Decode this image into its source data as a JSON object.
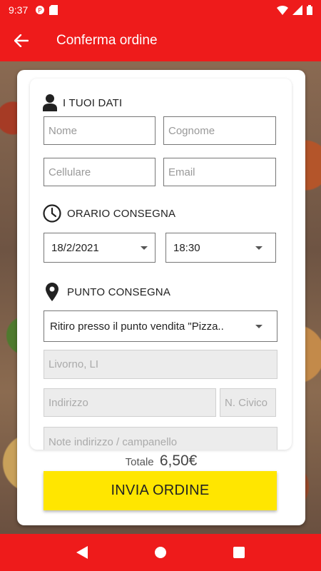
{
  "status_bar": {
    "time": "9:37"
  },
  "app_bar": {
    "title": "Conferma ordine"
  },
  "sections": {
    "personal": {
      "heading": "I TUOI DATI"
    },
    "schedule": {
      "heading": "ORARIO CONSEGNA"
    },
    "location": {
      "heading": "PUNTO CONSEGNA"
    }
  },
  "fields": {
    "nome": {
      "placeholder": "Nome"
    },
    "cognome": {
      "placeholder": "Cognome"
    },
    "cellulare": {
      "placeholder": "Cellulare"
    },
    "email": {
      "placeholder": "Email"
    },
    "date": {
      "value": "18/2/2021"
    },
    "time": {
      "value": "18:30"
    },
    "delivery_point": {
      "value": "Ritiro presso il punto vendita \"Pizza.."
    },
    "city": {
      "value": "Livorno, LI"
    },
    "indirizzo": {
      "placeholder": "Indirizzo"
    },
    "civico": {
      "placeholder": "N. Civico"
    },
    "note": {
      "placeholder": "Note indirizzo / campanello"
    }
  },
  "summary": {
    "total_label": "Totale",
    "total_value": "6,50€"
  },
  "actions": {
    "submit_label": "INVIA ORDINE"
  },
  "colors": {
    "primary": "#ee1b1b",
    "submit": "#ffe600"
  },
  "icons": {
    "back": "arrow-left-icon",
    "personal": "person-icon",
    "schedule": "clock-icon",
    "location": "location-pin-icon",
    "nav_back": "triangle-back-icon",
    "nav_home": "circle-home-icon",
    "nav_recents": "square-recents-icon"
  }
}
